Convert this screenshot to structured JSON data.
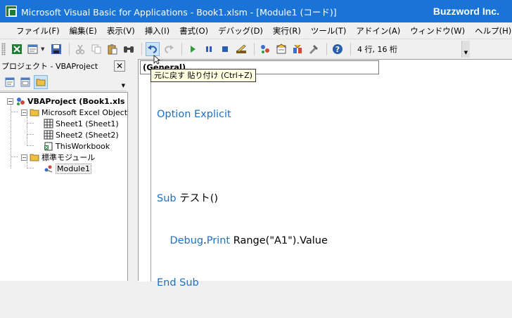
{
  "window": {
    "title": "Microsoft Visual Basic for Applications - Book1.xlsm - [Module1 (コード)]",
    "brand": "Buzzword Inc."
  },
  "menu": {
    "items": [
      "ファイル(F)",
      "編集(E)",
      "表示(V)",
      "挿入(I)",
      "書式(O)",
      "デバッグ(D)",
      "実行(R)",
      "ツール(T)",
      "アドイン(A)",
      "ウィンドウ(W)",
      "ヘルプ(H)"
    ]
  },
  "toolbar": {
    "status": "4 行, 16 桁",
    "tooltip": "元に戻す 貼り付け (Ctrl+Z)",
    "icons": [
      "excel-view-icon",
      "insert-module-icon",
      "save-icon",
      "cut-icon",
      "copy-icon",
      "paste-icon",
      "find-icon",
      "undo-icon",
      "redo-icon",
      "run-icon",
      "break-icon",
      "reset-icon",
      "design-mode-icon",
      "project-explorer-icon",
      "properties-icon",
      "object-browser-icon",
      "toolbox-icon",
      "help-icon"
    ]
  },
  "project_panel": {
    "title": "プロジェクト - VBAProject",
    "close": "✕",
    "tree": {
      "root": "VBAProject (Book1.xls",
      "excel_objects": "Microsoft Excel Object",
      "sheet1": "Sheet1 (Sheet1)",
      "sheet2": "Sheet2 (Sheet2)",
      "workbook": "ThisWorkbook",
      "modules": "標準モジュール",
      "module1": "Module1"
    }
  },
  "code": {
    "object_combo": "(General)",
    "lines": [
      {
        "kw1": "Option Explicit",
        "rest": ""
      },
      {
        "kw1": "",
        "rest": ""
      },
      {
        "kw1": "Sub",
        "rest": " テスト()"
      },
      {
        "indent": "    ",
        "kw1": "Debug",
        "dot": ".",
        "kw2": "Print",
        "rest": " Range(\"A1\").Value"
      },
      {
        "kw1": "End Sub",
        "rest": ""
      }
    ]
  },
  "colors": {
    "titlebar": "#1a73d6",
    "keyword": "#1f6fbf"
  }
}
